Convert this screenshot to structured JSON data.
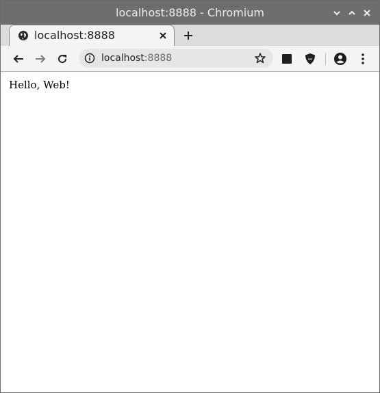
{
  "window": {
    "title": "localhost:8888 - Chromium",
    "controls": [
      "chevron-down-icon",
      "chevron-up-icon",
      "close-icon"
    ]
  },
  "tab": {
    "label": "localhost:8888",
    "favicon": "globe-icon"
  },
  "toolbar": {
    "url_host": "localhost",
    "url_port": ":8888",
    "buttons": [
      "back-icon",
      "forward-icon",
      "reload-icon",
      "star-icon",
      "extension-square-icon",
      "ublock-shield-icon",
      "account-icon",
      "menu-dots-icon"
    ]
  },
  "page": {
    "text": "Hello, Web!"
  },
  "colors": {
    "titlebar": "#6e6e6e",
    "tabstrip": "#dcdcdc",
    "toolbar": "#f4f4f4",
    "omnibox": "#e6e6e6"
  }
}
